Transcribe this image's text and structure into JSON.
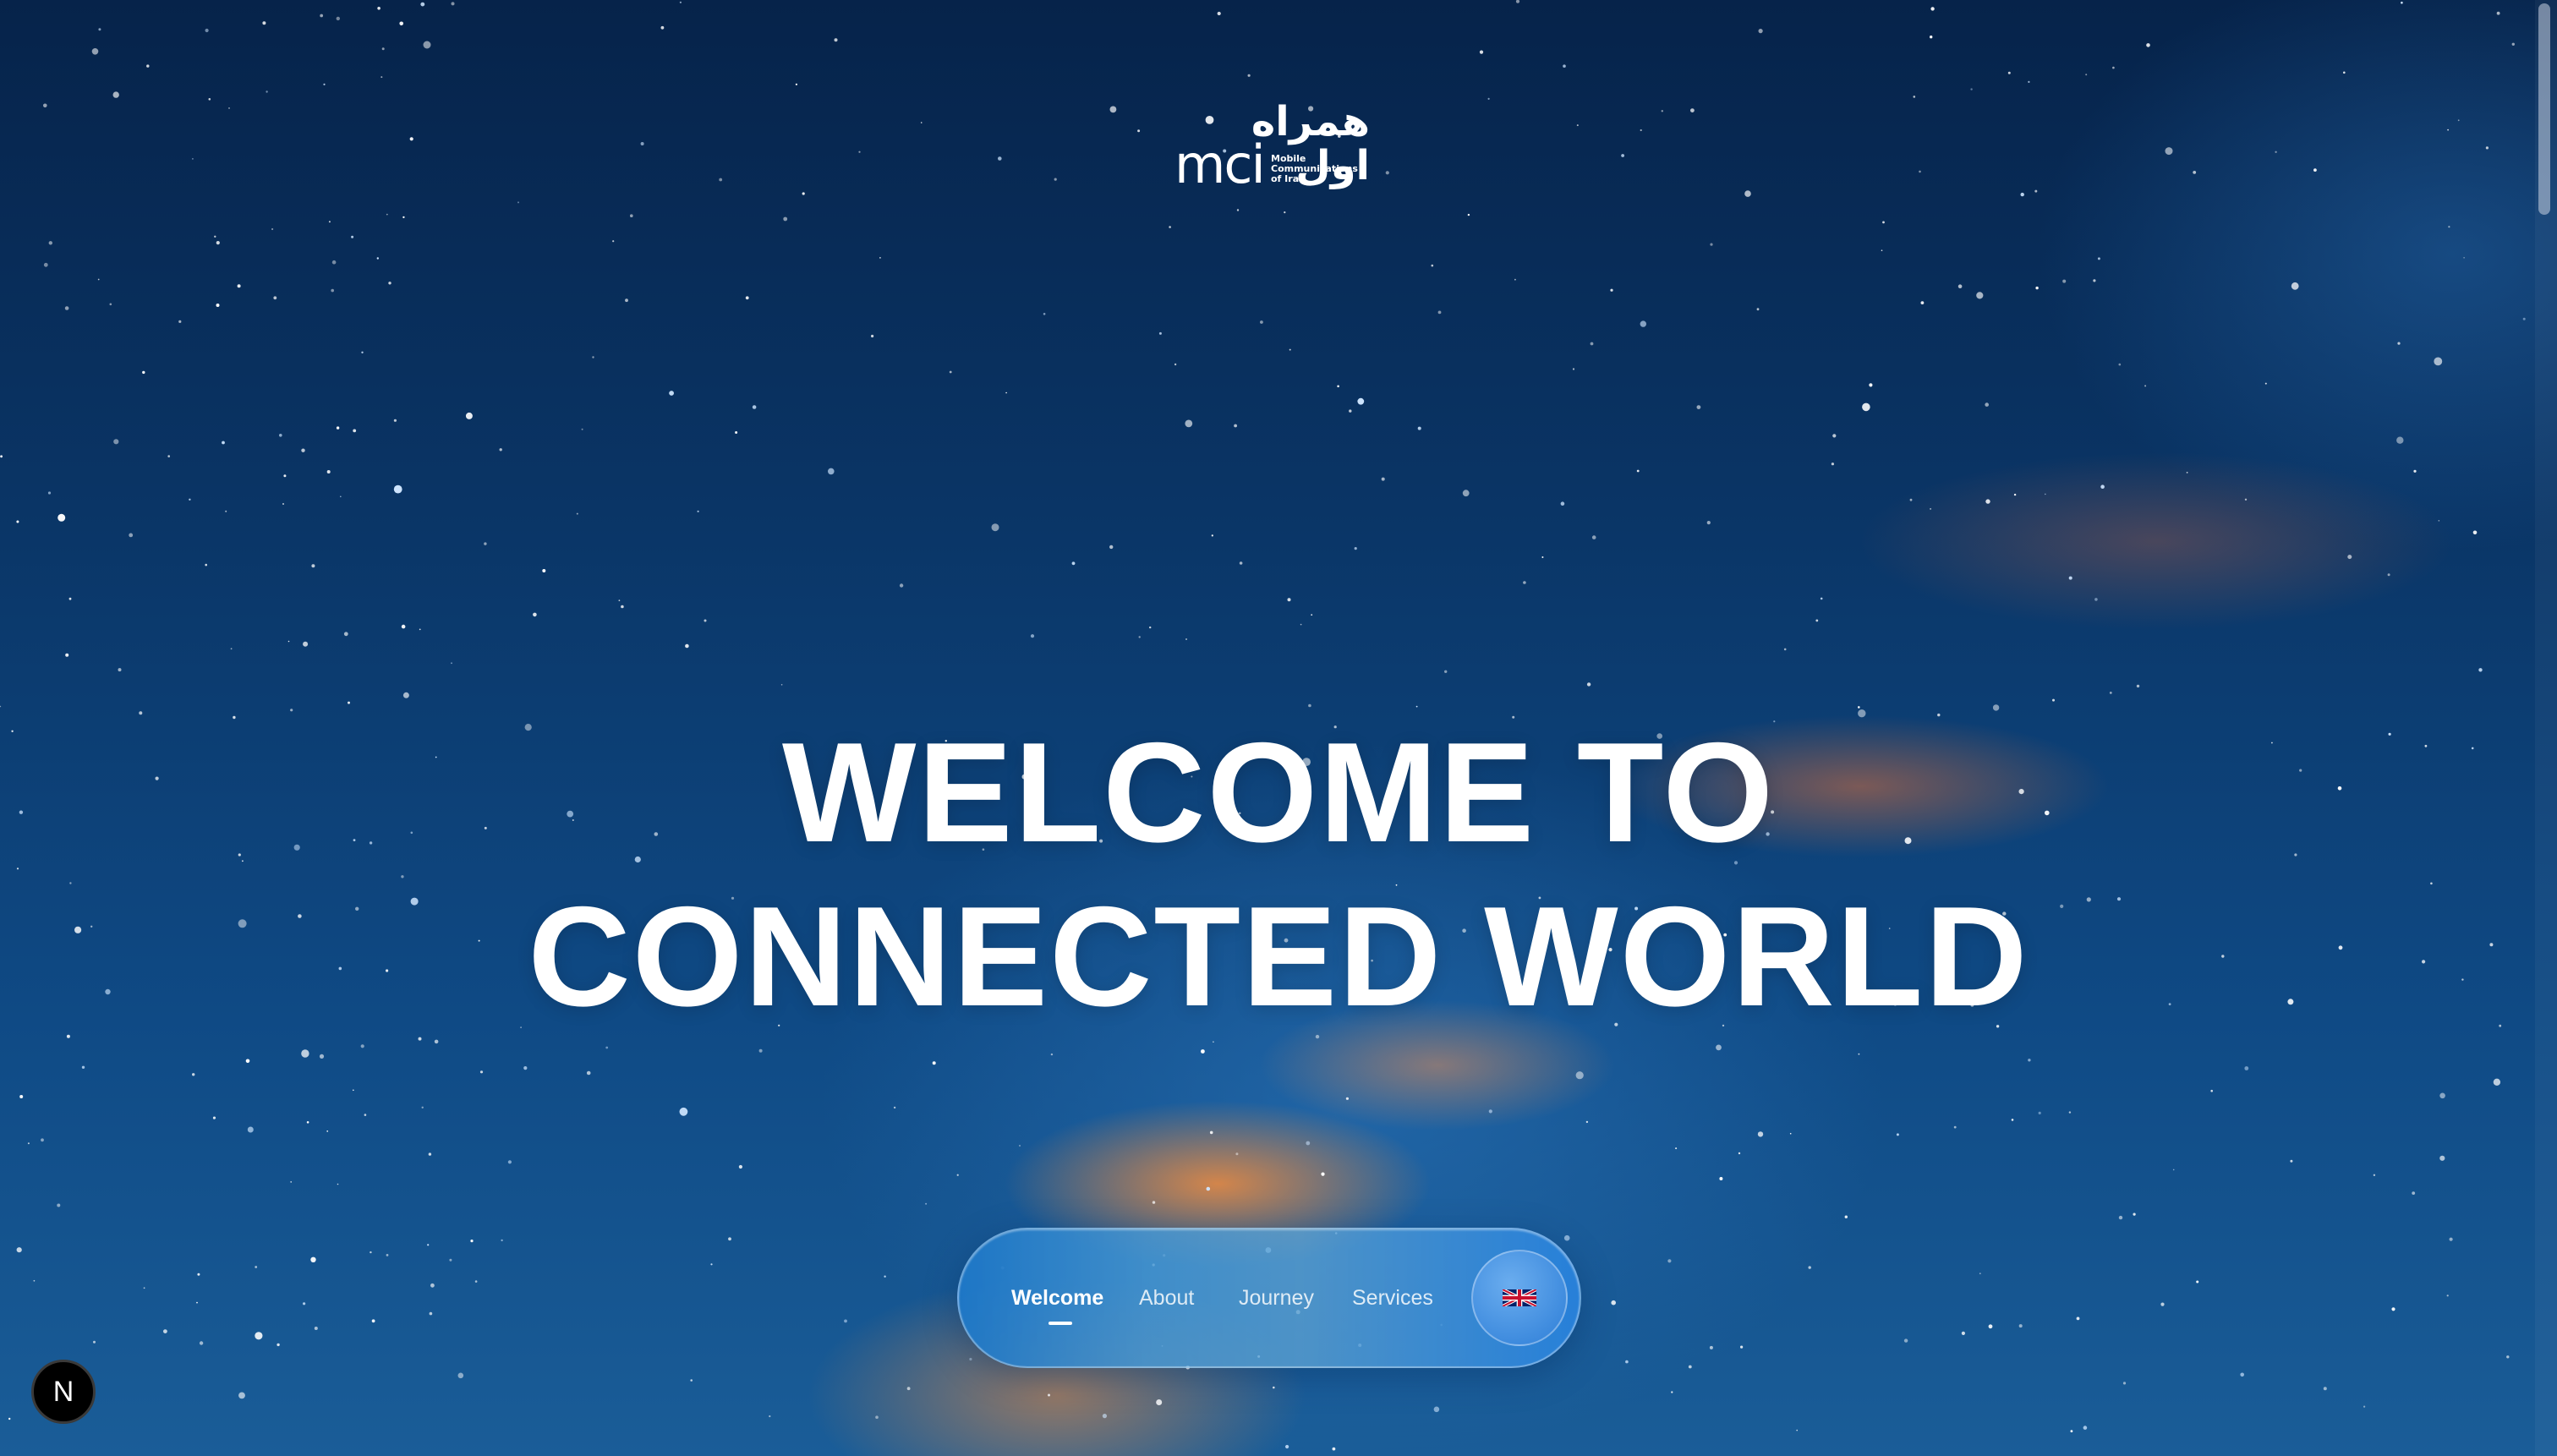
{
  "logo": {
    "persian": "همراه اول",
    "brand": "mci",
    "tagline": "Mobile\nCommunications\nof Iran"
  },
  "hero": {
    "line1": "WELCOME TO",
    "line2": "CONNECTED WORLD"
  },
  "nav": {
    "items": [
      {
        "label": "Welcome",
        "active": true
      },
      {
        "label": "About",
        "active": false
      },
      {
        "label": "Journey",
        "active": false
      },
      {
        "label": "Services",
        "active": false
      }
    ],
    "language_icon": "uk-flag-icon"
  },
  "badge": {
    "label": "N"
  }
}
